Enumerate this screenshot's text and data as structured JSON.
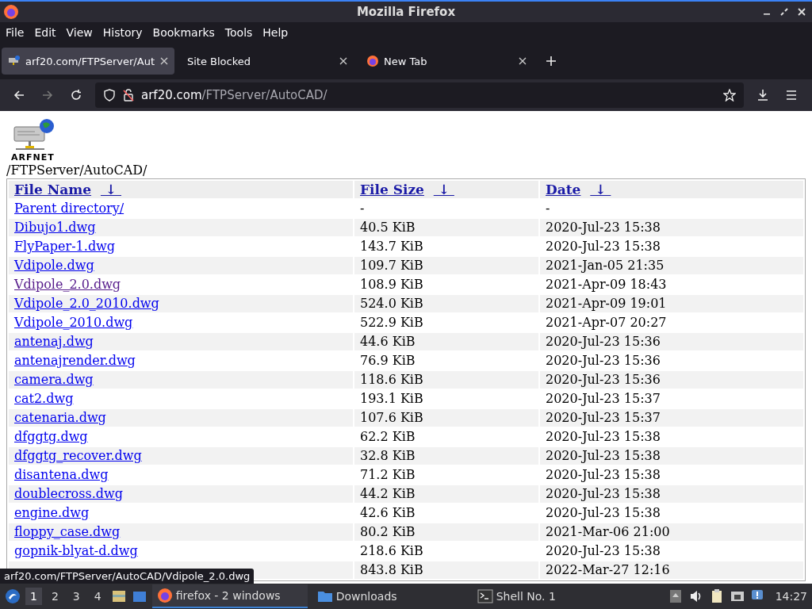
{
  "window": {
    "title": "Mozilla Firefox"
  },
  "menu": [
    "File",
    "Edit",
    "View",
    "History",
    "Bookmarks",
    "Tools",
    "Help"
  ],
  "tabs": [
    {
      "label": "arf20.com/FTPServer/Aut",
      "selected": true
    },
    {
      "label": "Site Blocked",
      "selected": false
    },
    {
      "label": "New Tab",
      "selected": false
    }
  ],
  "address": {
    "host": "arf20.com",
    "path": "/FTPServer/AutoCAD/"
  },
  "page": {
    "logo_text": "ARFNET",
    "heading": "/FTPServer/AutoCAD/",
    "columns": [
      {
        "label": "File Name",
        "sort": "↓"
      },
      {
        "label": "File Size",
        "sort": "↓"
      },
      {
        "label": "Date",
        "sort": "↓"
      }
    ],
    "rows": [
      {
        "name": "Parent directory/",
        "size": "-",
        "date": "-",
        "visited": false
      },
      {
        "name": "Dibujo1.dwg",
        "size": "40.5 KiB",
        "date": "2020-Jul-23 15:38",
        "visited": false
      },
      {
        "name": "FlyPaper-1.dwg",
        "size": "143.7 KiB",
        "date": "2020-Jul-23 15:38",
        "visited": false
      },
      {
        "name": "Vdipole.dwg",
        "size": "109.7 KiB",
        "date": "2021-Jan-05 21:35",
        "visited": false
      },
      {
        "name": "Vdipole_2.0.dwg",
        "size": "108.9 KiB",
        "date": "2021-Apr-09 18:43",
        "visited": true
      },
      {
        "name": "Vdipole_2.0_2010.dwg",
        "size": "524.0 KiB",
        "date": "2021-Apr-09 19:01",
        "visited": false
      },
      {
        "name": "Vdipole_2010.dwg",
        "size": "522.9 KiB",
        "date": "2021-Apr-07 20:27",
        "visited": false
      },
      {
        "name": "antenaj.dwg",
        "size": "44.6 KiB",
        "date": "2020-Jul-23 15:36",
        "visited": false
      },
      {
        "name": "antenajrender.dwg",
        "size": "76.9 KiB",
        "date": "2020-Jul-23 15:36",
        "visited": false
      },
      {
        "name": "camera.dwg",
        "size": "118.6 KiB",
        "date": "2020-Jul-23 15:36",
        "visited": false
      },
      {
        "name": "cat2.dwg",
        "size": "193.1 KiB",
        "date": "2020-Jul-23 15:37",
        "visited": false
      },
      {
        "name": "catenaria.dwg",
        "size": "107.6 KiB",
        "date": "2020-Jul-23 15:37",
        "visited": false
      },
      {
        "name": "dfggtg.dwg",
        "size": "62.2 KiB",
        "date": "2020-Jul-23 15:38",
        "visited": false
      },
      {
        "name": "dfggtg_recover.dwg",
        "size": "32.8 KiB",
        "date": "2020-Jul-23 15:38",
        "visited": false
      },
      {
        "name": "disantena.dwg",
        "size": "71.2 KiB",
        "date": "2020-Jul-23 15:38",
        "visited": false
      },
      {
        "name": "doublecross.dwg",
        "size": "44.2 KiB",
        "date": "2020-Jul-23 15:38",
        "visited": false
      },
      {
        "name": "engine.dwg",
        "size": "42.6 KiB",
        "date": "2020-Jul-23 15:38",
        "visited": false
      },
      {
        "name": "floppy_case.dwg",
        "size": "80.2 KiB",
        "date": "2021-Mar-06 21:00",
        "visited": false
      },
      {
        "name": "gopnik-blyat-d.dwg",
        "size": "218.6 KiB",
        "date": "2020-Jul-23 15:38",
        "visited": false
      },
      {
        "size": "843.8 KiB",
        "date": "2022-Mar-27 12:16"
      }
    ]
  },
  "status_url": "arf20.com/FTPServer/AutoCAD/Vdipole_2.0.dwg",
  "taskbar": {
    "workspaces": [
      {
        "label": "1",
        "selected": true
      },
      {
        "label": "2",
        "selected": false
      },
      {
        "label": "3",
        "selected": false
      },
      {
        "label": "4",
        "selected": false
      }
    ],
    "tasks": [
      {
        "label": "firefox - 2 windows",
        "selected": true
      },
      {
        "label": "Downloads",
        "selected": false
      },
      {
        "label": "Shell No. 1",
        "selected": false
      }
    ],
    "clock": "14:27"
  }
}
